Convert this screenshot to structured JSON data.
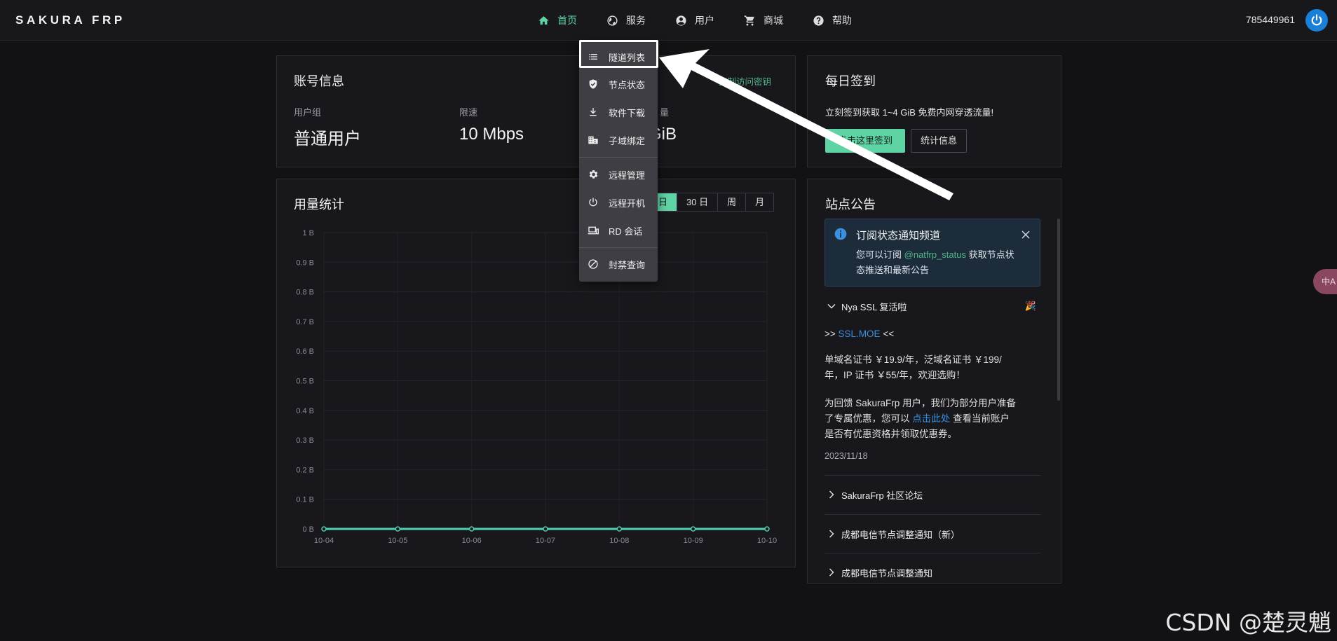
{
  "brand": "SAKURA FRP",
  "nav": [
    {
      "label": "首页",
      "icon": "home-icon"
    },
    {
      "label": "服务",
      "icon": "globe-icon"
    },
    {
      "label": "用户",
      "icon": "user-circle-icon"
    },
    {
      "label": "商城",
      "icon": "cart-icon"
    },
    {
      "label": "帮助",
      "icon": "help-icon"
    }
  ],
  "user_id": "785449961",
  "dropdown": {
    "items": [
      {
        "label": "隧道列表",
        "icon": "list-icon"
      },
      {
        "label": "节点状态",
        "icon": "shield-check-icon"
      },
      {
        "label": "软件下载",
        "icon": "download-icon"
      },
      {
        "label": "子域绑定",
        "icon": "domain-icon"
      },
      {
        "label": "远程管理",
        "icon": "gear-icon"
      },
      {
        "label": "远程开机",
        "icon": "power-icon"
      },
      {
        "label": "RD 会话",
        "icon": "devices-icon"
      },
      {
        "label": "封禁查询",
        "icon": "ban-icon"
      }
    ]
  },
  "account": {
    "title": "账号信息",
    "copy_link": "复制访问密钥",
    "group_label": "用户组",
    "group_value": "普通用户",
    "speed_label": "限速",
    "speed_value": "10 Mbps",
    "traffic_label": "量",
    "traffic_value": "GiB"
  },
  "checkin": {
    "title": "每日签到",
    "desc": "立刻签到获取 1~4 GiB 免费内网穿透流量!",
    "checkin_button": "点击这里签到",
    "stats_button": "统计信息"
  },
  "usage": {
    "title": "用量统计",
    "ranges": [
      "日",
      "30 日",
      "周",
      "月"
    ],
    "active_range": 0
  },
  "chart_data": {
    "type": "line",
    "x": [
      "10-04",
      "10-05",
      "10-06",
      "10-07",
      "10-08",
      "10-09",
      "10-10"
    ],
    "series": [
      {
        "values": [
          0,
          0,
          0,
          0,
          0,
          0,
          0
        ]
      }
    ],
    "yticks": [
      "0 B",
      "0.1 B",
      "0.2 B",
      "0.3 B",
      "0.4 B",
      "0.5 B",
      "0.6 B",
      "0.7 B",
      "0.8 B",
      "0.9 B",
      "1 B"
    ],
    "ylim": [
      0,
      1
    ],
    "color": "#4fd1b2"
  },
  "notice": {
    "title": "站点公告",
    "alert_title": "订阅状态通知频道",
    "alert_text_1": "您可以订阅",
    "alert_link": "@natfrp_status",
    "alert_text_2": "获取节点状",
    "alert_text_3": "态推送和最新公告",
    "item1_title": "Nya SSL 复活啦",
    "item1_prefix": ">>",
    "item1_link": "SSL.MOE",
    "item1_suffix": "<<",
    "item1_para1_line1": "单域名证书 ￥19.9/年，泛域名证书 ￥199/",
    "item1_para1_line2": "年，IP 证书 ￥55/年，欢迎选购！",
    "item1_para2_line1": "为回馈 SakuraFrp 用户，我们为部分用户准备",
    "item1_para2_line2a": "了专属优惠，您可以",
    "item1_para2_link": "点击此处",
    "item1_para2_line2b": "查看当前账户",
    "item1_para2_line3": "是否有优惠资格并领取优惠券。",
    "item1_date": "2023/11/18",
    "item2_title": "SakuraFrp 社区论坛",
    "item3_title": "成都电信节点调整通知（新）",
    "item4_title": "成都电信节点调整通知"
  },
  "side_tab": "中A",
  "watermark": "CSDN @楚灵魈"
}
